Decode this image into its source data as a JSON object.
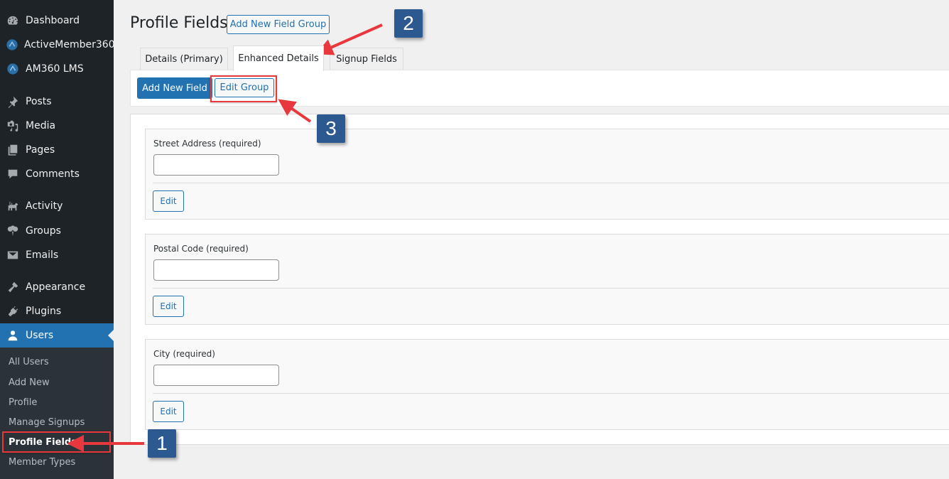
{
  "sidebar": {
    "items": [
      {
        "label": "Dashboard",
        "icon": "dashboard-icon"
      },
      {
        "label": "ActiveMember360",
        "icon": "activemember360-icon"
      },
      {
        "label": "AM360 LMS",
        "icon": "am360-lms-icon"
      },
      {
        "label": "Posts",
        "icon": "pin-icon"
      },
      {
        "label": "Media",
        "icon": "media-icon"
      },
      {
        "label": "Pages",
        "icon": "pages-icon"
      },
      {
        "label": "Comments",
        "icon": "comment-icon"
      },
      {
        "label": "Activity",
        "icon": "activity-icon"
      },
      {
        "label": "Groups",
        "icon": "groups-icon"
      },
      {
        "label": "Emails",
        "icon": "email-icon"
      },
      {
        "label": "Appearance",
        "icon": "brush-icon"
      },
      {
        "label": "Plugins",
        "icon": "plugin-icon"
      },
      {
        "label": "Users",
        "icon": "user-icon",
        "current": true
      }
    ],
    "submenu": [
      {
        "label": "All Users"
      },
      {
        "label": "Add New"
      },
      {
        "label": "Profile"
      },
      {
        "label": "Manage Signups"
      },
      {
        "label": "Profile Fields",
        "current": true
      },
      {
        "label": "Member Types"
      }
    ]
  },
  "header": {
    "title": "Profile Fields",
    "add_group_label": "Add New Field Group"
  },
  "tabs": [
    {
      "label": "Details (Primary)"
    },
    {
      "label": "Enhanced Details",
      "active": true
    },
    {
      "label": "Signup Fields"
    }
  ],
  "toolbar": {
    "add_field_label": "Add New Field",
    "edit_group_label": "Edit Group"
  },
  "fields": [
    {
      "label": "Street Address (required)",
      "value": "",
      "edit_label": "Edit"
    },
    {
      "label": "Postal Code (required)",
      "value": "",
      "edit_label": "Edit"
    },
    {
      "label": "City (required)",
      "value": "",
      "edit_label": "Edit"
    }
  ],
  "annotations": {
    "callouts": [
      "1",
      "2",
      "3"
    ],
    "color_highlight": "#e8383d",
    "color_callout": "#2d5991"
  },
  "colors": {
    "sidebar_bg": "#1d2327",
    "accent": "#2271b1"
  }
}
